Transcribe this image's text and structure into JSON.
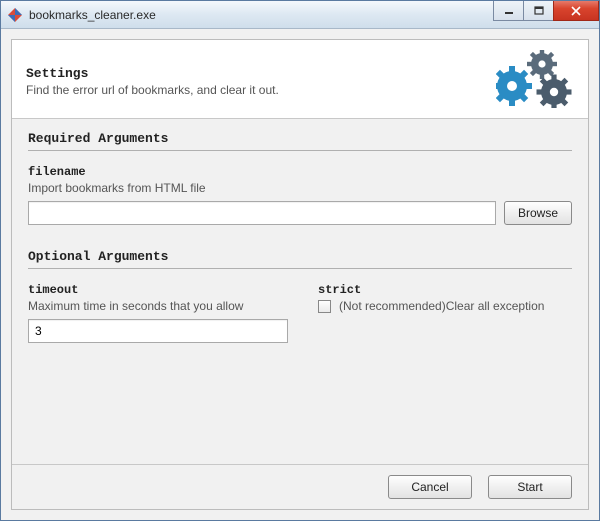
{
  "window": {
    "title": "bookmarks_cleaner.exe"
  },
  "header": {
    "title": "Settings",
    "description": "Find the error url of bookmarks, and clear it out."
  },
  "sections": {
    "required": {
      "title": "Required Arguments",
      "filename": {
        "label": "filename",
        "hint": "Import bookmarks from HTML file",
        "value": "",
        "browse_label": "Browse"
      }
    },
    "optional": {
      "title": "Optional Arguments",
      "timeout": {
        "label": "timeout",
        "hint": "Maximum time in seconds that you allow",
        "value": "3"
      },
      "strict": {
        "label": "strict",
        "checked": false,
        "text": "(Not recommended)Clear all exception"
      }
    }
  },
  "footer": {
    "cancel": "Cancel",
    "start": "Start"
  },
  "colors": {
    "gear_blue": "#2a8cc4",
    "gear_gray": "#5a6b7b"
  }
}
